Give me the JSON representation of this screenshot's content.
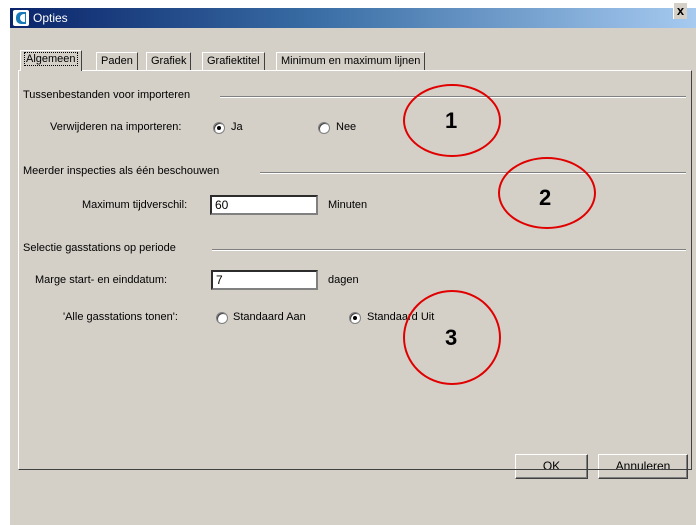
{
  "window": {
    "title": "Opties",
    "close_glyph": "x"
  },
  "tabs": [
    {
      "label": "Algemeen",
      "active": true
    },
    {
      "label": "Paden"
    },
    {
      "label": "Grafiek"
    },
    {
      "label": "Grafiektitel"
    },
    {
      "label": "Minimum en maximum lijnen"
    }
  ],
  "groups": {
    "import": {
      "title": "Tussenbestanden voor importeren",
      "field_label": "Verwijderen na importeren:",
      "options": [
        "Ja",
        "Nee"
      ],
      "selected": "Ja"
    },
    "inspections": {
      "title": "Meerder inspecties als één beschouwen",
      "field_label": "Maximum tijdverschil:",
      "value": "60",
      "unit": "Minuten"
    },
    "stations": {
      "title": "Selectie gasstations op periode",
      "margin_label": "Marge start- en einddatum:",
      "margin_value": "7",
      "margin_unit": "dagen",
      "show_all_label": "'Alle gasstations tonen':",
      "options": [
        "Standaard Aan",
        "Standaard Uit"
      ],
      "selected": "Standaard Uit"
    }
  },
  "buttons": {
    "ok": "OK",
    "cancel": "Annuleren"
  },
  "annotations": [
    "1",
    "2",
    "3"
  ],
  "colors": {
    "annotation": "#e00000",
    "dialog_bg": "#d4d0c8",
    "titlebar": "#0a246a"
  }
}
